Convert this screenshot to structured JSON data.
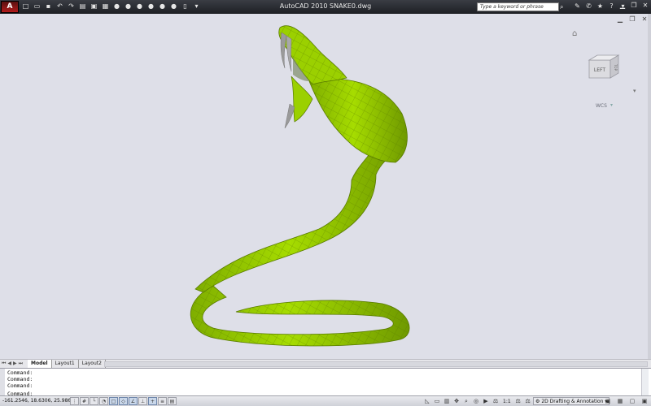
{
  "window": {
    "app_button_label": "A",
    "title": "AutoCAD 2010    SNAKE0.dwg",
    "search_placeholder": "Type a keyword or phrase"
  },
  "quick_access": [
    {
      "name": "new-icon",
      "glyph": "□"
    },
    {
      "name": "open-icon",
      "glyph": "▭"
    },
    {
      "name": "save-icon",
      "glyph": "▪"
    },
    {
      "name": "undo-icon",
      "glyph": "↶"
    },
    {
      "name": "redo-icon",
      "glyph": "↷"
    },
    {
      "name": "plot-icon",
      "glyph": "▤"
    },
    {
      "name": "publish-icon",
      "glyph": "▣"
    },
    {
      "name": "sheet-icon",
      "glyph": "▦"
    },
    {
      "name": "tool-1-icon",
      "glyph": "●"
    },
    {
      "name": "tool-2-icon",
      "glyph": "●"
    },
    {
      "name": "tool-3-icon",
      "glyph": "●"
    },
    {
      "name": "tool-4-icon",
      "glyph": "●"
    },
    {
      "name": "tool-5-icon",
      "glyph": "●"
    },
    {
      "name": "tool-6-icon",
      "glyph": "●"
    },
    {
      "name": "properties-icon",
      "glyph": "▯"
    },
    {
      "name": "qat-dropdown-icon",
      "glyph": "▾"
    }
  ],
  "viewcube": {
    "face_left": "LEFT",
    "face_top": "TOP",
    "wcs_label": "WCS"
  },
  "tabs": [
    {
      "label": "Model",
      "active": true
    },
    {
      "label": "Layout1",
      "active": false
    },
    {
      "label": "Layout2",
      "active": false
    }
  ],
  "command_lines": [
    "Command:",
    "Command:",
    "Command:",
    "",
    "Command:"
  ],
  "status": {
    "coordinates": "-161.2546, 18.6306, 25.9866",
    "annotation_scale": "1:1",
    "workspace": "2D Drafting & Annotation"
  },
  "colors": {
    "snake_fill": "#9bd000",
    "snake_shade": "#6f9900",
    "fang": "#9a9a9a",
    "viewport_bg": "#dedfe8",
    "titlebar": "#2a2c31"
  }
}
